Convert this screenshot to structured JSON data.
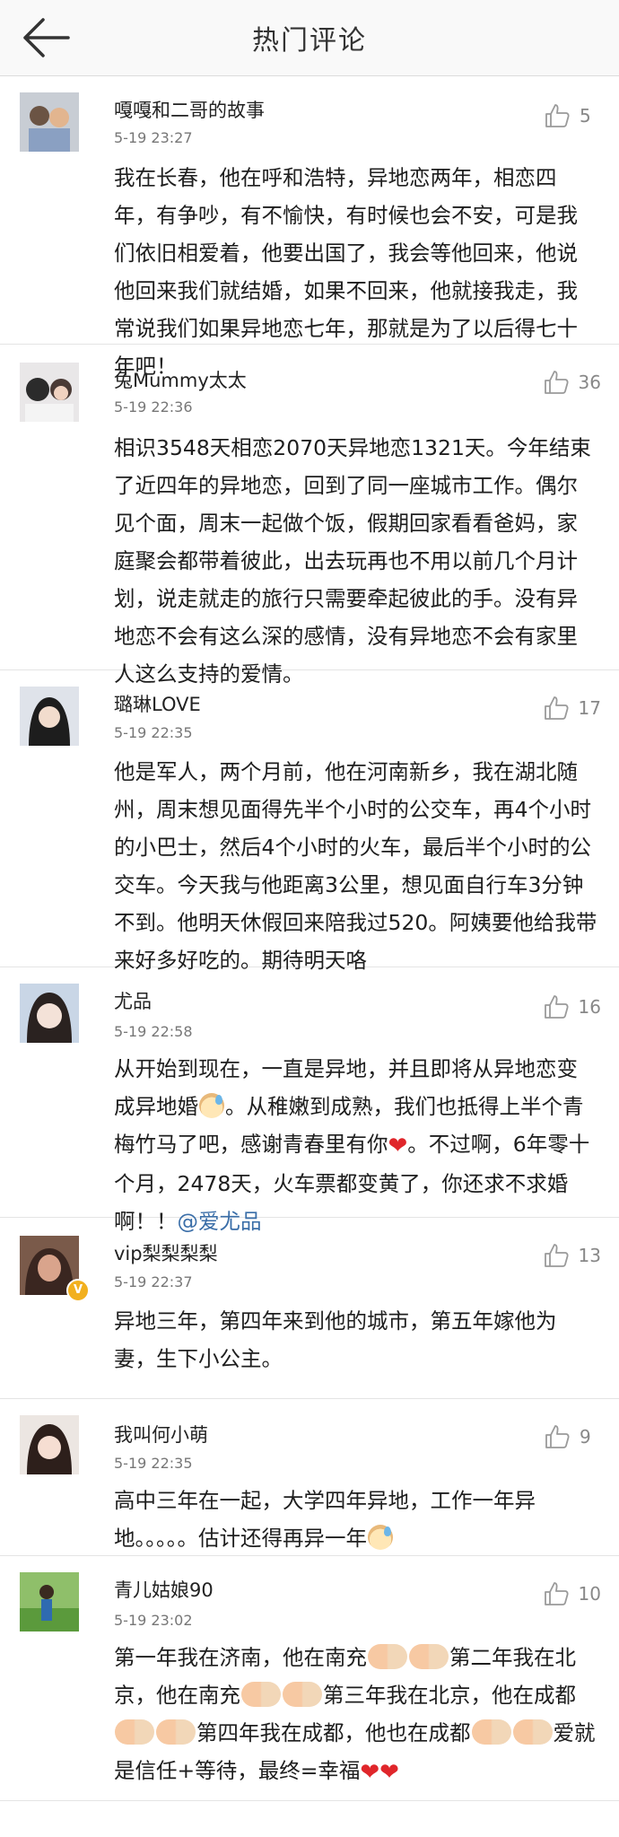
{
  "header": {
    "title": "热门评论"
  },
  "colors": {
    "like": "#9a9a9a",
    "mention": "#3a6ea8",
    "heart": "#e0262b",
    "vip_badge": "#f2b01e"
  },
  "comments": [
    {
      "user": "嘎嘎和二哥的故事",
      "time": "5-19 23:27",
      "likes": "5",
      "text": "我在长春，他在呼和浩特，异地恋两年，相恋四年，有争吵，有不愉快，有时候也会不安，可是我们依旧相爱着，他要出国了，我会等他回来，他说他回来我们就结婚，如果不回来，他就接我走，我常说我们如果异地恋七年，那就是为了以后得七十年吧！"
    },
    {
      "user": "兔Mummy太太",
      "time": "5-19 22:36",
      "likes": "36",
      "text": "相识3548天相恋2070天异地恋1321天。今年结束了近四年的异地恋，回到了同一座城市工作。偶尔见个面，周末一起做个饭，假期回家看看爸妈，家庭聚会都带着彼此，出去玩再也不用以前几个月计划，说走就走的旅行只需要牵起彼此的手。没有异地恋不会有这么深的感情，没有异地恋不会有家里人这么支持的爱情。"
    },
    {
      "user": "璐琳LOVE",
      "time": "5-19 22:35",
      "likes": "17",
      "text": "他是军人，两个月前，他在河南新乡，我在湖北随州，周末想见面得先半个小时的公交车，再4个小时的小巴士，然后4个小时的火车，最后半个小时的公交车。今天我与他距离3公里，想见面自行车3分钟不到。他明天休假回来陪我过520。阿姨要他给我带来好多好吃的。期待明天咯"
    },
    {
      "user": "尤品",
      "time": "5-19 22:58",
      "likes": "16",
      "text_a": "从开始到现在，一直是异地，并且即将从异地恋变成异地婚",
      "text_b": "。从稚嫩到成熟，我们也抵得上半个青梅竹马了吧，感谢青春里有你",
      "text_c": "。不过啊，6年零十个月，2478天，火车票都变黄了，你还求不求婚啊！！",
      "mention": "@爱尤品",
      "heart": "❤"
    },
    {
      "user": "vip梨梨梨梨",
      "time": "5-19 22:37",
      "likes": "13",
      "badge": "V",
      "text": "异地三年，第四年来到他的城市，第五年嫁他为妻，生下小公主。"
    },
    {
      "user": "我叫何小萌",
      "time": "5-19 22:35",
      "likes": "9",
      "text": "高中三年在一起，大学四年异地，工作一年异地。。。。。估计还得再异一年"
    },
    {
      "user": "青儿姑娘90",
      "time": "5-19 23:02",
      "likes": "10",
      "text_a": "第一年我在济南，他在南充",
      "text_b": "第二年我在北京，他在南充",
      "text_c": "第三年我在北京，他在成都",
      "text_d": "第四年我在成都，他也在成都",
      "text_e": "爱就是信任+等待，最终=幸福",
      "hearts": "❤❤"
    }
  ]
}
